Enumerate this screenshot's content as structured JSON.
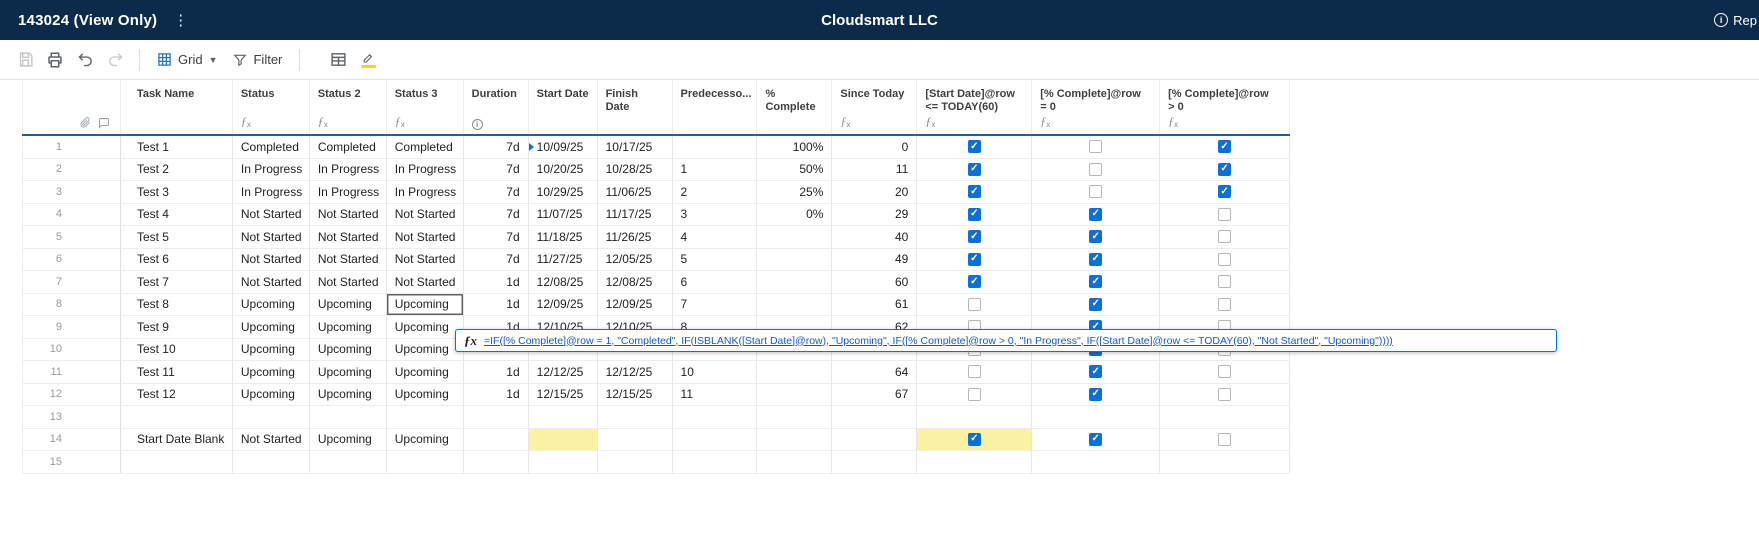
{
  "topbar": {
    "title": "143024 (View Only)",
    "brand": "Cloudsmart LLC",
    "right_label": "Rep"
  },
  "toolbar": {
    "grid_label": "Grid",
    "filter_label": "Filter"
  },
  "columns": [
    {
      "label": "Task Name",
      "label2": "",
      "sub": ""
    },
    {
      "label": "Status",
      "label2": "",
      "sub": "fx"
    },
    {
      "label": "Status 2",
      "label2": "",
      "sub": "fx"
    },
    {
      "label": "Status 3",
      "label2": "",
      "sub": "fx"
    },
    {
      "label": "Duration",
      "label2": "",
      "sub": "info"
    },
    {
      "label": "Start Date",
      "label2": "",
      "sub": ""
    },
    {
      "label": "Finish",
      "label2": "Date",
      "sub": ""
    },
    {
      "label": "Predecesso...",
      "label2": "",
      "sub": ""
    },
    {
      "label": "%",
      "label2": "Complete",
      "sub": ""
    },
    {
      "label": "Since Today",
      "label2": "",
      "sub": "fx"
    },
    {
      "label": "[Start Date]@row",
      "label2": "<= TODAY(60)",
      "sub": "fx"
    },
    {
      "label": "[% Complete]@row",
      "label2": "= 0",
      "sub": "fx"
    },
    {
      "label": "[% Complete]@row",
      "label2": "> 0",
      "sub": "fx"
    }
  ],
  "rows": [
    {
      "num": "1",
      "task": "Test 1",
      "status": "Completed",
      "status2": "Completed",
      "status3": "Completed",
      "dur": "7d",
      "start": "10/09/25",
      "finish": "10/17/25",
      "pred": "",
      "pct": "100%",
      "since": "0",
      "cb": [
        "checked",
        "unchecked",
        "checked"
      ],
      "start_marker": true
    },
    {
      "num": "2",
      "task": "Test 2",
      "status": "In Progress",
      "status2": "In Progress",
      "status3": "In Progress",
      "dur": "7d",
      "start": "10/20/25",
      "finish": "10/28/25",
      "pred": "1",
      "pct": "50%",
      "since": "11",
      "cb": [
        "checked",
        "unchecked",
        "checked"
      ]
    },
    {
      "num": "3",
      "task": "Test 3",
      "status": "In Progress",
      "status2": "In Progress",
      "status3": "In Progress",
      "dur": "7d",
      "start": "10/29/25",
      "finish": "11/06/25",
      "pred": "2",
      "pct": "25%",
      "since": "20",
      "cb": [
        "checked",
        "unchecked",
        "checked"
      ]
    },
    {
      "num": "4",
      "task": "Test 4",
      "status": "Not Started",
      "status2": "Not Started",
      "status3": "Not Started",
      "dur": "7d",
      "start": "11/07/25",
      "finish": "11/17/25",
      "pred": "3",
      "pct": "0%",
      "since": "29",
      "cb": [
        "checked",
        "checked",
        "unchecked"
      ]
    },
    {
      "num": "5",
      "task": "Test 5",
      "status": "Not Started",
      "status2": "Not Started",
      "status3": "Not Started",
      "dur": "7d",
      "start": "11/18/25",
      "finish": "11/26/25",
      "pred": "4",
      "pct": "",
      "since": "40",
      "cb": [
        "checked",
        "checked",
        "unchecked"
      ]
    },
    {
      "num": "6",
      "task": "Test 6",
      "status": "Not Started",
      "status2": "Not Started",
      "status3": "Not Started",
      "dur": "7d",
      "start": "11/27/25",
      "finish": "12/05/25",
      "pred": "5",
      "pct": "",
      "since": "49",
      "cb": [
        "checked",
        "checked",
        "unchecked"
      ]
    },
    {
      "num": "7",
      "task": "Test 7",
      "status": "Not Started",
      "status2": "Not Started",
      "status3": "Not Started",
      "dur": "1d",
      "start": "12/08/25",
      "finish": "12/08/25",
      "pred": "6",
      "pct": "",
      "since": "60",
      "cb": [
        "checked",
        "checked",
        "unchecked"
      ]
    },
    {
      "num": "8",
      "task": "Test 8",
      "status": "Upcoming",
      "status2": "Upcoming",
      "status3": "Upcoming",
      "dur": "1d",
      "start": "12/09/25",
      "finish": "12/09/25",
      "pred": "7",
      "pct": "",
      "since": "61",
      "cb": [
        "unchecked",
        "checked",
        "unchecked"
      ],
      "selected": true
    },
    {
      "num": "9",
      "task": "Test 9",
      "status": "Upcoming",
      "status2": "Upcoming",
      "status3": "Upcoming",
      "dur": "1d",
      "start": "12/10/25",
      "finish": "12/10/25",
      "pred": "8",
      "pct": "",
      "since": "62",
      "cb": [
        "unchecked",
        "checked",
        "unchecked"
      ]
    },
    {
      "num": "10",
      "task": "Test 10",
      "status": "Upcoming",
      "status2": "Upcoming",
      "status3": "Upcoming",
      "dur": "",
      "start": "",
      "finish": "",
      "pred": "",
      "pct": "",
      "since": "",
      "cb": [
        "unchecked",
        "checked",
        "unchecked"
      ]
    },
    {
      "num": "11",
      "task": "Test 11",
      "status": "Upcoming",
      "status2": "Upcoming",
      "status3": "Upcoming",
      "dur": "1d",
      "start": "12/12/25",
      "finish": "12/12/25",
      "pred": "10",
      "pct": "",
      "since": "64",
      "cb": [
        "unchecked",
        "checked",
        "unchecked"
      ]
    },
    {
      "num": "12",
      "task": "Test 12",
      "status": "Upcoming",
      "status2": "Upcoming",
      "status3": "Upcoming",
      "dur": "1d",
      "start": "12/15/25",
      "finish": "12/15/25",
      "pred": "11",
      "pct": "",
      "since": "67",
      "cb": [
        "unchecked",
        "checked",
        "unchecked"
      ]
    },
    {
      "num": "13",
      "task": "",
      "status": "",
      "status2": "",
      "status3": "",
      "dur": "",
      "start": "",
      "finish": "",
      "pred": "",
      "pct": "",
      "since": "",
      "cb": [
        "none",
        "none",
        "none"
      ]
    },
    {
      "num": "14",
      "task": "Start Date Blank",
      "status": "Not Started",
      "status2": "Upcoming",
      "status3": "Upcoming",
      "dur": "",
      "start": "",
      "finish": "",
      "pred": "",
      "pct": "",
      "since": "",
      "cb": [
        "checked",
        "checked",
        "unchecked"
      ],
      "start_yellow": true,
      "cb1_yellow": true
    },
    {
      "num": "15",
      "task": "",
      "status": "",
      "status2": "",
      "status3": "",
      "dur": "",
      "start": "",
      "finish": "",
      "pred": "",
      "pct": "",
      "since": "",
      "cb": [
        "none",
        "none",
        "none"
      ]
    }
  ],
  "formula": {
    "fx_label": "ƒx",
    "text": "=IF([% Complete]@row = 1, \"Completed\", IF(ISBLANK([Start Date]@row), \"Upcoming\", IF([% Complete]@row > 0, \"In Progress\", IF([Start Date]@row <= TODAY(60), \"Not Started\", \"Upcoming\"))))"
  },
  "colors": {
    "accent_blue": "#0d6fd8",
    "header_line_blue": "#1b5faa",
    "highlight_yellow": "#fbf3a3",
    "topbar_navy": "#0c2b4a",
    "formula_link_blue": "#1558d6"
  }
}
